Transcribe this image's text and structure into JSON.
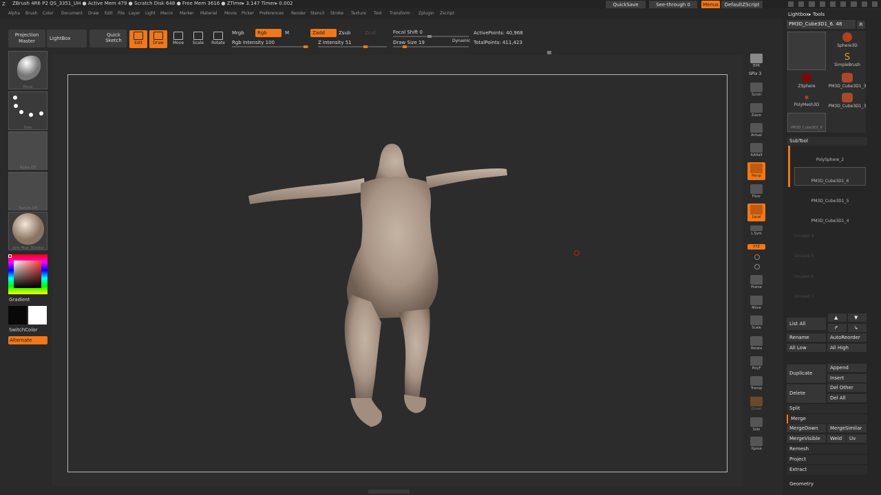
{
  "app": {
    "title": "ZBrush 4R6 P2    QS_3351_UH    ● Active Mem 479 ● Scratch Disk 648 ● Free Mem 3616 ● ZTime▸ 3.147 Timer▸ 0.002",
    "quicksave": "QuickSave",
    "see_through": "See-through  0",
    "menus": "Menus",
    "script": "DefaultZScript"
  },
  "menubar": [
    "Alpha",
    "Brush",
    "Color",
    "Document",
    "Draw",
    "Edit",
    "File",
    "Layer",
    "Light",
    "Macro",
    "Marker",
    "Material",
    "Movie",
    "Picker",
    "Preferences",
    "Render",
    "Stencil",
    "Stroke",
    "Texture",
    "Tool",
    "Transform",
    "Zplugin",
    "Zscript"
  ],
  "topshelf": {
    "projection_master": "Projection Master",
    "lightbox": "LightBox",
    "quick_sketch": "Quick Sketch",
    "edit": "Edit",
    "draw": "Draw",
    "move": "Move",
    "scale": "Scale",
    "rotate": "Rotate",
    "mrgb": "Mrgb",
    "rgb": "Rgb",
    "m": "M",
    "zadd": "Zadd",
    "zsub": "Zsub",
    "zcut": "Zcut",
    "rgb_intensity": "Rgb Intensity 100",
    "z_intensity": "Z Intensity 51",
    "focal_shift": "Focal Shift 0",
    "draw_size": "Draw Size 19",
    "dynamic": "Dynamic",
    "active_points": "ActivePoints: 40,968",
    "total_points": "TotalPoints: 411,423"
  },
  "leftpanel": {
    "brush_caption": "Move",
    "stroke_caption": "Dots",
    "alpha_caption": "Alpha Off",
    "texture_caption": "Texture Off",
    "material_caption": "zbro_Mud_3Dcolor",
    "gradient": "Gradient",
    "switchcolor": "SwitchColor",
    "alternate": "Alternate"
  },
  "rightshelf": [
    "BPR",
    "SPix 3",
    "Scroll",
    "Zoom",
    "Actual",
    "AAHalf",
    "Persp",
    "Floor",
    "Local",
    "L.Sym",
    "XYZ",
    "",
    "",
    "Frame",
    "Move",
    "Scale",
    "Rotate",
    "PolyF",
    "Transp",
    "Ghost",
    "Solo",
    "Xpose"
  ],
  "tray": {
    "lightbox_tools": "Lightbox▸ Tools",
    "current_tool": "PM3D_Cube3D1_6. 48",
    "r": "R",
    "tools": [
      "Sphere3D",
      "SimpleBrush",
      "ZSphere",
      "PM3D_Cube3D1_3",
      "PolyMesh3D",
      "PM3D_Cube3D1_3",
      "PM3D_Cube3D1_6"
    ],
    "subtool_header": "SubTool",
    "subtools": [
      "PolySphere_2",
      "PM3D_Cube3D1_6",
      "PM3D_Cube3D1_5",
      "PM3D_Cube3D1_4",
      "Unused 4",
      "Unused 5",
      "Unused 6",
      "Unused 7"
    ],
    "list_all": "List All",
    "rename": "Rename",
    "autoreorder": "AutoReorder",
    "all_low": "All Low",
    "all_high": "All High",
    "duplicate": "Duplicate",
    "append": "Append",
    "insert": "Insert",
    "delete": "Delete",
    "del_other": "Del Other",
    "del_all": "Del All",
    "split": "Split",
    "merge": "Merge",
    "mergedown": "MergeDown",
    "mergesimilar": "MergeSimilar",
    "mergevisible": "MergeVisible",
    "weld": "Weld",
    "uv": "Uv",
    "remesh": "Remesh",
    "project": "Project",
    "extract": "Extract",
    "geometry": "Geometry"
  },
  "colors": {
    "accent": "#f07818",
    "bg": "#2a2a2a",
    "model": "#a89888"
  }
}
